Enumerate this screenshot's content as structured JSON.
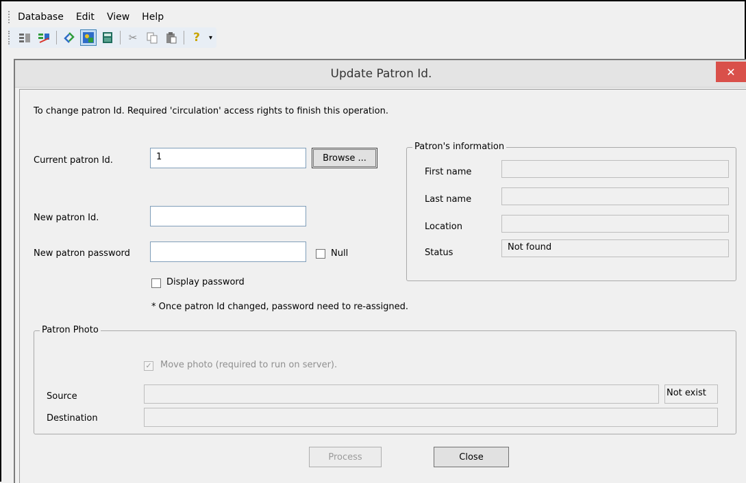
{
  "menu": {
    "items": [
      "Database",
      "Edit",
      "View",
      "Help"
    ]
  },
  "toolbar": {
    "icons": [
      "patron-list-icon",
      "patron-edit-icon",
      "refresh-icon",
      "update-patron-icon",
      "calculator-icon",
      "cut-icon",
      "copy-icon",
      "paste-icon",
      "help-icon"
    ],
    "colors": {
      "green": "#2e9c3a",
      "red": "#d9352b",
      "blue": "#2e6cc7",
      "yellow": "#e8c220"
    }
  },
  "dialog": {
    "title": "Update Patron Id.",
    "close_label": "✕",
    "instructions": "To change patron Id.  Required 'circulation' access rights to finish this operation.",
    "current_id_label": "Current patron Id.",
    "current_id_value": "1",
    "browse_label": "Browse ...",
    "new_id_label": "New patron Id.",
    "new_id_value": "",
    "new_password_label": "New patron password",
    "new_password_value": "",
    "null_label": "Null",
    "display_password_label": "Display password",
    "note": "* Once patron Id changed, password need to re-assigned.",
    "patron_info": {
      "title": "Patron's information",
      "first_name_label": "First name",
      "last_name_label": "Last name",
      "location_label": "Location",
      "status_label": "Status",
      "status_value": "Not found"
    },
    "photo": {
      "title": "Patron Photo",
      "move_photo_label": "Move photo (required to run on server).",
      "source_label": "Source",
      "destination_label": "Destination",
      "source_status": "Not exist"
    },
    "process_label": "Process",
    "close_button_label": "Close",
    "accent_close": "#d9504a"
  }
}
